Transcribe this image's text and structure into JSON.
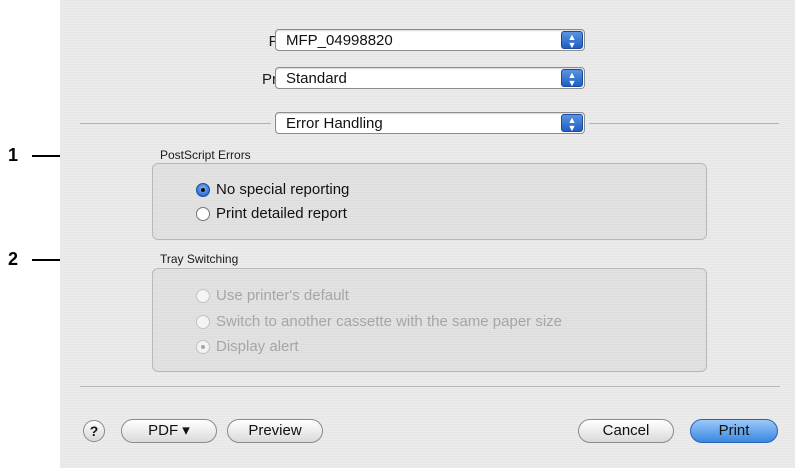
{
  "header": {
    "printer_label": "Printer:",
    "printer_value": "MFP_04998820",
    "presets_label": "Presets:",
    "presets_value": "Standard",
    "panel_value": "Error Handling"
  },
  "postscript_errors": {
    "title": "PostScript Errors",
    "options": [
      {
        "label": "No special reporting",
        "selected": true
      },
      {
        "label": "Print detailed report",
        "selected": false
      }
    ]
  },
  "tray_switching": {
    "title": "Tray Switching",
    "enabled": false,
    "options": [
      {
        "label": "Use printer's default",
        "selected": false
      },
      {
        "label": "Switch to another cassette with the same paper size",
        "selected": false
      },
      {
        "label": "Display alert",
        "selected": true
      }
    ]
  },
  "callouts": [
    "1",
    "2"
  ],
  "footer": {
    "help_label": "?",
    "pdf_label": "PDF ▾",
    "preview_label": "Preview",
    "cancel_label": "Cancel",
    "print_label": "Print"
  },
  "icons": {
    "popup_arrows": "up-down-arrows-icon"
  }
}
